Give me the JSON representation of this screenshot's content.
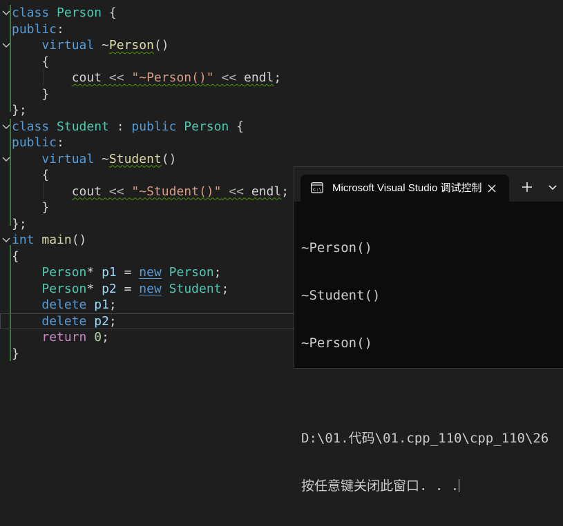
{
  "editor": {
    "lines": [
      {
        "tokens": [
          {
            "t": "class",
            "c": "kw"
          },
          {
            "t": " "
          },
          {
            "t": "Person",
            "c": "ty"
          },
          {
            "t": " {"
          }
        ]
      },
      {
        "tokens": [
          {
            "t": "public",
            "c": "kw"
          },
          {
            "t": ":"
          }
        ]
      },
      {
        "tokens": [
          {
            "t": "    "
          },
          {
            "t": "virtual",
            "c": "kw"
          },
          {
            "t": " ~"
          },
          {
            "t": "Person",
            "c": "fn sq"
          },
          {
            "t": "()"
          }
        ]
      },
      {
        "tokens": [
          {
            "t": "    {"
          }
        ]
      },
      {
        "tokens": [
          {
            "t": "        "
          },
          {
            "t": "cout",
            "c": "sq"
          },
          {
            "t": " << ",
            "c": "op sq"
          },
          {
            "t": "\"~Person()\"",
            "c": "str sq"
          },
          {
            "t": " << ",
            "c": "op sq"
          },
          {
            "t": "endl",
            "c": "sq"
          },
          {
            "t": ";"
          }
        ]
      },
      {
        "tokens": [
          {
            "t": "    }"
          }
        ]
      },
      {
        "tokens": [
          {
            "t": "};"
          }
        ]
      },
      {
        "tokens": [
          {
            "t": "class",
            "c": "kw"
          },
          {
            "t": " "
          },
          {
            "t": "Student",
            "c": "ty"
          },
          {
            "t": " : "
          },
          {
            "t": "public",
            "c": "kw"
          },
          {
            "t": " "
          },
          {
            "t": "Person",
            "c": "ty"
          },
          {
            "t": " {"
          }
        ]
      },
      {
        "tokens": [
          {
            "t": "public",
            "c": "kw"
          },
          {
            "t": ":"
          }
        ]
      },
      {
        "tokens": [
          {
            "t": "    "
          },
          {
            "t": "virtual",
            "c": "kw"
          },
          {
            "t": " ~"
          },
          {
            "t": "Student",
            "c": "fn sq"
          },
          {
            "t": "()"
          }
        ]
      },
      {
        "tokens": [
          {
            "t": "    {"
          }
        ]
      },
      {
        "tokens": [
          {
            "t": "        "
          },
          {
            "t": "cout",
            "c": "sq"
          },
          {
            "t": " << ",
            "c": "op sq"
          },
          {
            "t": "\"~Student()\"",
            "c": "str sq"
          },
          {
            "t": " << ",
            "c": "op sq"
          },
          {
            "t": "endl",
            "c": "sq"
          },
          {
            "t": ";"
          }
        ]
      },
      {
        "tokens": [
          {
            "t": "    }"
          }
        ]
      },
      {
        "tokens": [
          {
            "t": "};"
          }
        ]
      },
      {
        "tokens": [
          {
            "t": "int",
            "c": "kw"
          },
          {
            "t": " "
          },
          {
            "t": "main",
            "c": "fn"
          },
          {
            "t": "()"
          }
        ]
      },
      {
        "tokens": [
          {
            "t": "{"
          }
        ]
      },
      {
        "tokens": [
          {
            "t": "    "
          },
          {
            "t": "Person",
            "c": "ty"
          },
          {
            "t": "* "
          },
          {
            "t": "p1",
            "c": "var"
          },
          {
            "t": " = "
          },
          {
            "t": "new",
            "c": "kw sqv"
          },
          {
            "t": " "
          },
          {
            "t": "Person",
            "c": "ty"
          },
          {
            "t": ";"
          }
        ]
      },
      {
        "tokens": [
          {
            "t": "    "
          },
          {
            "t": "Person",
            "c": "ty"
          },
          {
            "t": "* "
          },
          {
            "t": "p2",
            "c": "var"
          },
          {
            "t": " = "
          },
          {
            "t": "new",
            "c": "kw sqv"
          },
          {
            "t": " "
          },
          {
            "t": "Student",
            "c": "ty"
          },
          {
            "t": ";"
          }
        ]
      },
      {
        "tokens": [
          {
            "t": "    "
          },
          {
            "t": "delete",
            "c": "kw"
          },
          {
            "t": " "
          },
          {
            "t": "p1",
            "c": "var"
          },
          {
            "t": ";"
          }
        ]
      },
      {
        "tokens": [
          {
            "t": "    "
          },
          {
            "t": "delete",
            "c": "kw"
          },
          {
            "t": " "
          },
          {
            "t": "p2",
            "c": "var"
          },
          {
            "t": ";"
          }
        ]
      },
      {
        "tokens": [
          {
            "t": "    "
          },
          {
            "t": "return",
            "c": "ctl"
          },
          {
            "t": " "
          },
          {
            "t": "0",
            "c": "num"
          },
          {
            "t": ";"
          }
        ]
      },
      {
        "tokens": [
          {
            "t": "}"
          }
        ]
      }
    ],
    "fold_lines": [
      0,
      2,
      7,
      9,
      14
    ],
    "current_line": 19
  },
  "terminal": {
    "tab_title": "Microsoft Visual Studio 调试控制台",
    "new_tab_label": "+",
    "output": [
      "~Person()",
      "~Student()",
      "~Person()",
      "",
      "D:\\01.代码\\01.cpp_110\\cpp_110\\26",
      "按任意键关闭此窗口. . ."
    ]
  },
  "colors": {
    "editor_bg": "#1e1e1e",
    "keyword": "#569cd6",
    "type": "#4ec9b0",
    "function": "#dcdcaa",
    "string": "#d69d85",
    "terminal_bg": "#0c0c0c"
  }
}
